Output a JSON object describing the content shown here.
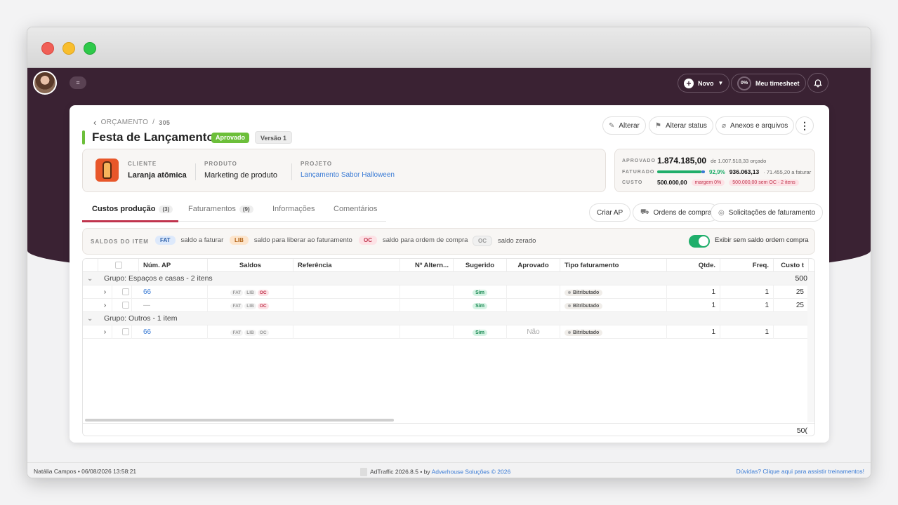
{
  "window": {
    "title": "AdTraffic"
  },
  "topbar": {
    "menu_icon": "menu-icon",
    "new_label": "Novo",
    "timesheet_pct": "0%",
    "timesheet_label": "Meu timesheet"
  },
  "breadcrumb": {
    "section": "ORÇAMENTO",
    "sep": "/",
    "number": "305"
  },
  "page": {
    "title": "Festa de Lançamento",
    "status": "Aprovado",
    "version": "Versão 1"
  },
  "actions": {
    "edit": "Alterar",
    "change_status": "Alterar status",
    "attachments": "Anexos e arquivos",
    "more": "⋮"
  },
  "info": {
    "client_label": "CLIENTE",
    "client_value": "Laranja atômica",
    "product_label": "PRODUTO",
    "product_value": "Marketing de produto",
    "project_label": "PROJETO",
    "project_value": "Lançamento Sabor Halloween"
  },
  "finance": {
    "approved_label": "APROVADO",
    "approved_value": "1.874.185,00",
    "approved_note": "de 1.007.518,33 orçado",
    "billed_label": "FATURADO",
    "billed_progress": 0.929,
    "billed_pct": "92,9%",
    "billed_value": "936.063,13",
    "billed_note": "· 71.455,20 a faturar",
    "cost_label": "CUSTO",
    "cost_value": "500.000,00",
    "margin_pill": "margem 0%",
    "oc_pill": "500.000,00 sem OC · 2 itens"
  },
  "tabs": [
    {
      "label": "Custos produção",
      "count": "(3)"
    },
    {
      "label": "Faturamentos",
      "count": "(9)"
    },
    {
      "label": "Informações",
      "count": ""
    },
    {
      "label": "Comentários",
      "count": ""
    }
  ],
  "tab_actions": {
    "create_ap": "Criar AP",
    "purchase_orders": "Ordens de compra",
    "billing_requests": "Solicitações de faturamento"
  },
  "saldos": {
    "title": "SALDOS DO ITEM",
    "fat_chip": "FAT",
    "fat_text": "saldo a faturar",
    "lib_chip": "LIB",
    "lib_text": "saldo para liberar ao faturamento",
    "oc_chip": "OC",
    "oc_text": "saldo para ordem de compra",
    "zero_chip": "OC",
    "zero_text": "saldo zerado",
    "toggle_on": true,
    "toggle_label": "Exibir sem saldo ordem compra"
  },
  "table": {
    "headers": [
      "Núm. AP",
      "Saldos",
      "Referência",
      "Nº Altern...",
      "Sugerido",
      "Aprovado",
      "Tipo faturamento",
      "Qtde.",
      "Freq.",
      "Custo t"
    ],
    "groups": [
      {
        "label": "Grupo: Espaços e casas - 2 itens",
        "total": "500",
        "rows": [
          {
            "ap": "66",
            "fat": "FAT",
            "lib": "LIB",
            "oc": "OC",
            "sugerido": "Sim",
            "aprovado": "",
            "tipo": "Bitributado",
            "qtde": "1",
            "freq": "1",
            "custo": "25"
          },
          {
            "ap": "—",
            "fat": "FAT",
            "lib": "LIB",
            "oc": "OC",
            "sugerido": "Sim",
            "aprovado": "",
            "tipo": "Bitributado",
            "qtde": "1",
            "freq": "1",
            "custo": "25"
          }
        ]
      },
      {
        "label": "Grupo: Outros - 1 item",
        "total": "",
        "rows": [
          {
            "ap": "66",
            "fat": "FAT",
            "lib": "LIB",
            "oc": "OC",
            "sugerido": "Sim",
            "aprovado": "Não",
            "tipo": "Bitributado",
            "qtde": "1",
            "freq": "1",
            "custo": ""
          }
        ]
      }
    ],
    "footer_total": "50("
  },
  "footer": {
    "user": "Natália Campos • 06/08/2026 13:58:21",
    "app": "AdTraffic 2026.8.5 • by",
    "company": "Adverhouse Soluções © 2026",
    "help": "Dúvidas? Clique aqui para assistir treinamentos!"
  }
}
